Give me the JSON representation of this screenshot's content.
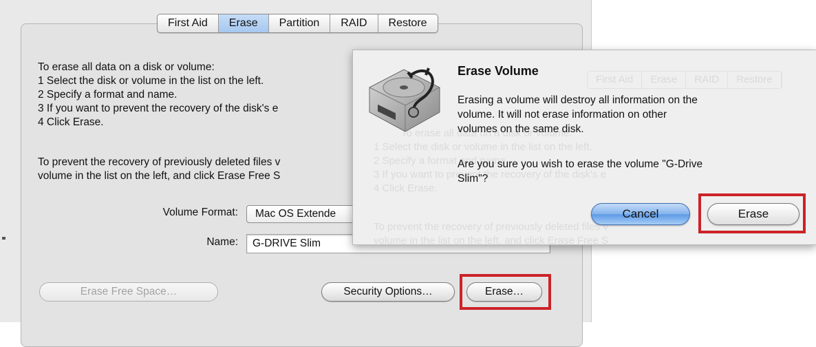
{
  "tabs": [
    "First Aid",
    "Erase",
    "Partition",
    "RAID",
    "Restore"
  ],
  "active_tab": "Erase",
  "instructions": [
    "To erase all data on a disk or volume:",
    "1 Select the disk or volume in the list on the left.",
    "2 Specify a format and name.",
    "3 If you want to prevent the recovery of the disk's e",
    "4 Click Erase."
  ],
  "prevent_text": [
    "To prevent the recovery of previously deleted files v",
    "volume in the list on the left, and click Erase Free S"
  ],
  "volume_format": {
    "label": "Volume Format:",
    "value": "Mac OS Extende"
  },
  "name_field": {
    "label": "Name:",
    "value": "G-DRIVE Slim"
  },
  "buttons": {
    "erase_free_space": "Erase Free Space…",
    "security_options": "Security Options…",
    "erase": "Erase…"
  },
  "dialog": {
    "title": "Erase Volume",
    "message": [
      "Erasing a volume will destroy all information on the",
      "volume. It will not erase information on other",
      "volumes on the same disk."
    ],
    "question": [
      "Are you sure you wish to erase the volume \"G-Drive",
      "Slim\"?"
    ],
    "cancel_label": "Cancel",
    "erase_label": "Erase",
    "icon": "disk-utility-icon"
  },
  "colors": {
    "highlight": "#cc2229",
    "default_button": "#83b3ec",
    "active_tab": "#a6c8f0"
  }
}
